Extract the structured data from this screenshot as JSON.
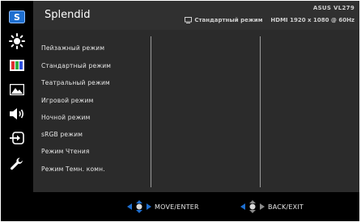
{
  "header": {
    "title": "Splendid",
    "model": "ASUS VL279",
    "current_mode": "Стандартный режим",
    "input_info": "HDMI 1920 x 1080 @ 60Hz"
  },
  "sidebar": {
    "items": [
      {
        "icon": "splendid-s-icon"
      },
      {
        "icon": "brightness-icon"
      },
      {
        "icon": "color-bars-icon"
      },
      {
        "icon": "image-icon"
      },
      {
        "icon": "sound-icon"
      },
      {
        "icon": "input-select-icon"
      },
      {
        "icon": "wrench-icon"
      }
    ]
  },
  "menu": {
    "items": [
      "Пейзажный режим",
      "Стандартный режим",
      "Театральный режим",
      "Игровой режим",
      "Ночной режим",
      "sRGB режим",
      "Режим Чтения",
      "Режим Темн. комн."
    ]
  },
  "footer": {
    "move_label": "MOVE/ENTER",
    "back_label": "BACK/EXIT"
  },
  "colors": {
    "accent": "#1e6fd0",
    "header_bg": "#303030",
    "content_bg": "#2b2b2b"
  }
}
